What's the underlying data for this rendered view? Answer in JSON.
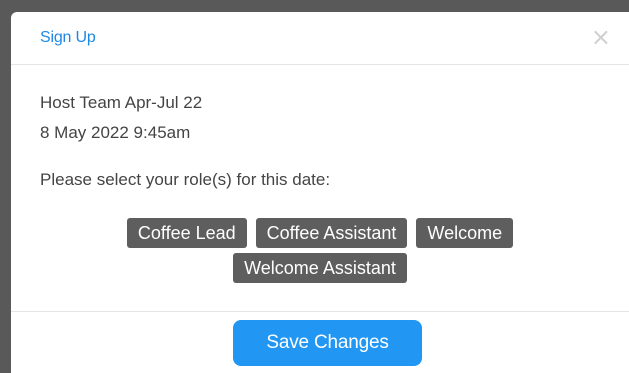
{
  "modal": {
    "title": "Sign Up",
    "close_symbol": "×",
    "close_icon": "close-icon"
  },
  "event": {
    "name": "Host Team Apr-Jul 22",
    "datetime": "8 May 2022 9:45am"
  },
  "prompt": "Please select your role(s) for this date:",
  "roles": [
    "Coffee Lead",
    "Coffee Assistant",
    "Welcome",
    "Welcome Assistant"
  ],
  "footer": {
    "save_label": "Save Changes"
  },
  "colors": {
    "accent": "#2196f3",
    "title": "#1e88e5",
    "role_button_bg": "#5e5e5e",
    "overlay": "#595959"
  }
}
